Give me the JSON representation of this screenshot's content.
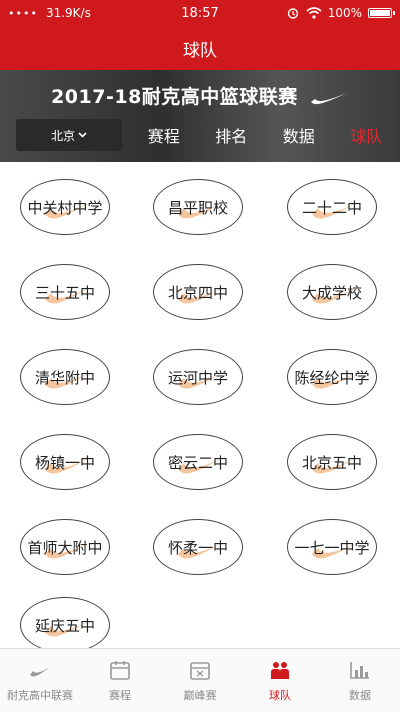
{
  "status": {
    "signal": "••••",
    "net_speed": "31.9K/s",
    "time": "18:57",
    "battery": "100%"
  },
  "navbar": {
    "title": "球队"
  },
  "banner": {
    "title": "2017-18耐克高中篮球联赛"
  },
  "city_selector": {
    "label": "北京"
  },
  "tabs": [
    {
      "label": "赛程"
    },
    {
      "label": "排名"
    },
    {
      "label": "数据"
    },
    {
      "label": "球队"
    }
  ],
  "teams": [
    "中关村中学",
    "昌平职校",
    "二十二中",
    "三十五中",
    "北京四中",
    "大成学校",
    "清华附中",
    "运河中学",
    "陈经纶中学",
    "杨镇一中",
    "密云二中",
    "北京五中",
    "首师大附中",
    "怀柔一中",
    "一七一中学",
    "延庆五中"
  ],
  "bottom_tabs": [
    {
      "label": "耐克高中联赛",
      "icon": "nike-logo-icon"
    },
    {
      "label": "赛程",
      "icon": "calendar-icon"
    },
    {
      "label": "巅峰赛",
      "icon": "calendar-x-icon"
    },
    {
      "label": "球队",
      "icon": "team-icon"
    },
    {
      "label": "数据",
      "icon": "chart-icon"
    }
  ],
  "colors": {
    "brand": "#d0191c",
    "active_tab": "#e5262a",
    "swoosh": "#f2b27c"
  }
}
